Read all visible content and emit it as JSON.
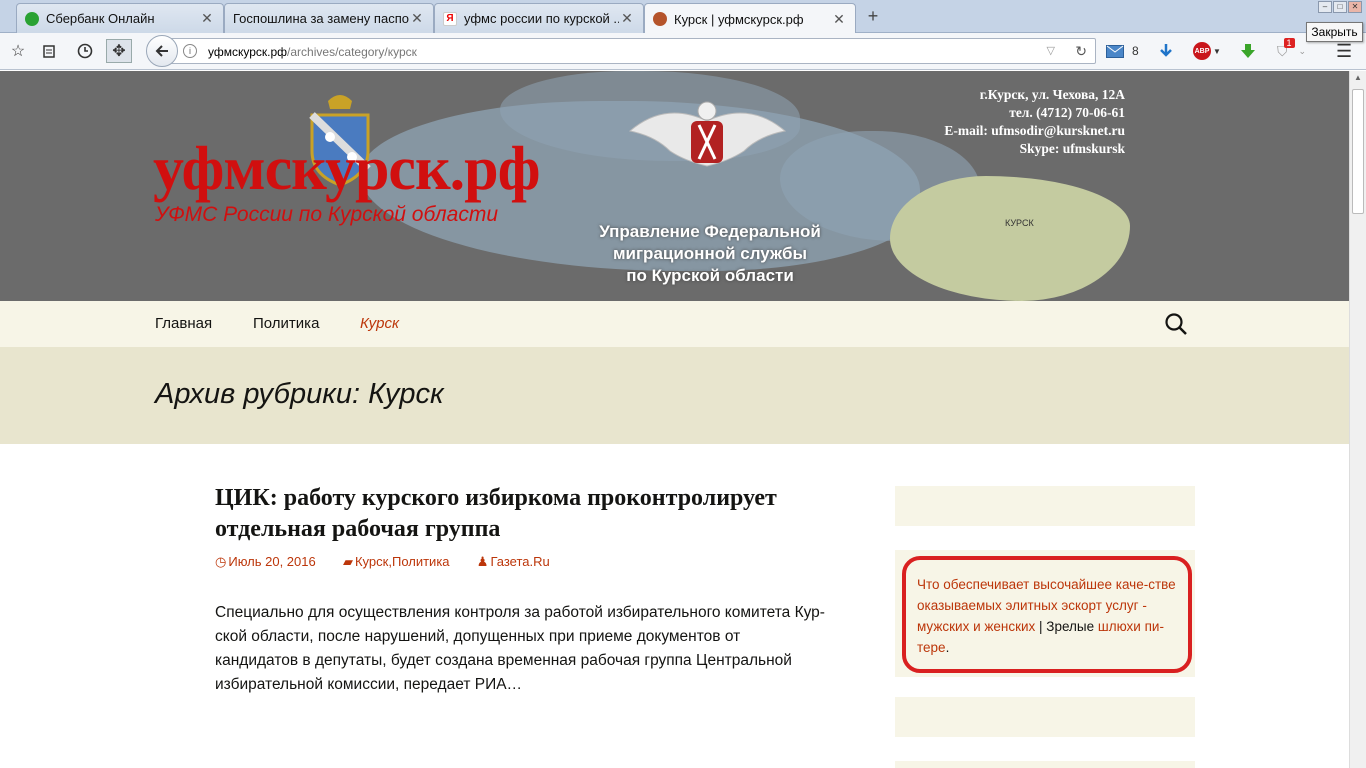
{
  "browser": {
    "tabs": [
      {
        "title": "Сбербанк Онлайн",
        "favicon": "sberbank-icon"
      },
      {
        "title": "Госпошлина за замену паспо...",
        "favicon": "blank-icon"
      },
      {
        "title": "уфмс россии по курской ...",
        "favicon": "yandex-icon"
      },
      {
        "title": "Курск | уфмскурск.рф",
        "favicon": "eagle-icon"
      }
    ],
    "new_tab": "+",
    "close_tooltip": "Закрыть",
    "url_host": "уфмскурск.рф",
    "url_path": "/archives/category/курск",
    "mail_count": "8",
    "shield_badge": "1",
    "abp_label": "ABP"
  },
  "header": {
    "site_title": "уфмскурск.рф",
    "site_description": "УФМС России по Курской области",
    "contacts": [
      "г.Курск, ул. Чехова, 12А",
      "тел. (4712) 70-06-61",
      "E-mail: ufmsodir@kursknet.ru",
      "Skype: ufmskursk"
    ],
    "agency_lines": [
      "Управление Федеральной",
      "миграционной службы",
      "по Курской области"
    ],
    "map_label": "КУРСК"
  },
  "menu": {
    "items": [
      "Главная",
      "Политика",
      "Курск"
    ]
  },
  "archive": {
    "title": "Архив рубрики: Курск"
  },
  "post": {
    "title": "ЦИК: работу курского избиркома проконтролирует отдельная рабочая группа",
    "date": "Июль 20, 2016",
    "categories": [
      "Курск",
      "Политика"
    ],
    "category_sep": ",",
    "author": "Газета.Ru",
    "excerpt": "Специально для осуществления контроля за работой избирательного комитета Кур-ской области, после нарушений, допущенных при приеме документов от кандидатов в депутаты, будет создана временная рабочая группа Центральной избирательной комиссии, передает РИА…"
  },
  "sidebar": {
    "ad_link1": "Что обеспечивает высочайшее каче-стве оказываемых элитных эскорт услуг - мужских и женских",
    "ad_sep": " | Зрелые ",
    "ad_link2": "шлюхи пи-тере",
    "ad_end": "."
  },
  "colors": {
    "accent": "#bc360a",
    "title_red": "#d10f0f",
    "menu_bg": "#f7f5e7",
    "archive_bg": "#e8e5ce",
    "ad_border": "#d92020"
  }
}
